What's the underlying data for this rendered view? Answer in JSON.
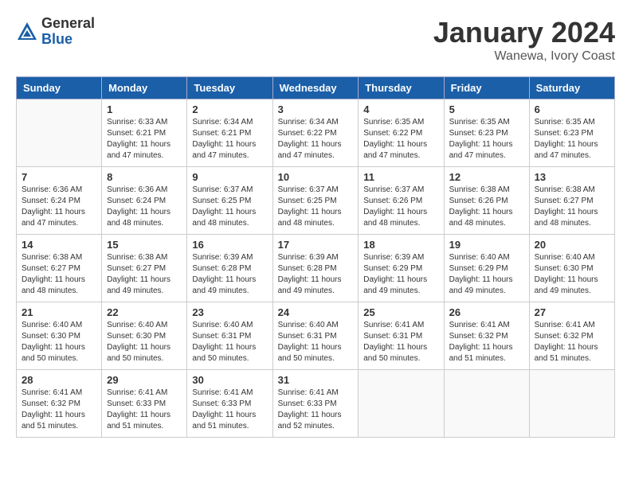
{
  "header": {
    "logo_general": "General",
    "logo_blue": "Blue",
    "month_title": "January 2024",
    "location": "Wanewa, Ivory Coast"
  },
  "weekdays": [
    "Sunday",
    "Monday",
    "Tuesday",
    "Wednesday",
    "Thursday",
    "Friday",
    "Saturday"
  ],
  "weeks": [
    [
      {
        "day": "",
        "sunrise": "",
        "sunset": "",
        "daylight": ""
      },
      {
        "day": "1",
        "sunrise": "Sunrise: 6:33 AM",
        "sunset": "Sunset: 6:21 PM",
        "daylight": "Daylight: 11 hours and 47 minutes."
      },
      {
        "day": "2",
        "sunrise": "Sunrise: 6:34 AM",
        "sunset": "Sunset: 6:21 PM",
        "daylight": "Daylight: 11 hours and 47 minutes."
      },
      {
        "day": "3",
        "sunrise": "Sunrise: 6:34 AM",
        "sunset": "Sunset: 6:22 PM",
        "daylight": "Daylight: 11 hours and 47 minutes."
      },
      {
        "day": "4",
        "sunrise": "Sunrise: 6:35 AM",
        "sunset": "Sunset: 6:22 PM",
        "daylight": "Daylight: 11 hours and 47 minutes."
      },
      {
        "day": "5",
        "sunrise": "Sunrise: 6:35 AM",
        "sunset": "Sunset: 6:23 PM",
        "daylight": "Daylight: 11 hours and 47 minutes."
      },
      {
        "day": "6",
        "sunrise": "Sunrise: 6:35 AM",
        "sunset": "Sunset: 6:23 PM",
        "daylight": "Daylight: 11 hours and 47 minutes."
      }
    ],
    [
      {
        "day": "7",
        "sunrise": "Sunrise: 6:36 AM",
        "sunset": "Sunset: 6:24 PM",
        "daylight": "Daylight: 11 hours and 47 minutes."
      },
      {
        "day": "8",
        "sunrise": "Sunrise: 6:36 AM",
        "sunset": "Sunset: 6:24 PM",
        "daylight": "Daylight: 11 hours and 48 minutes."
      },
      {
        "day": "9",
        "sunrise": "Sunrise: 6:37 AM",
        "sunset": "Sunset: 6:25 PM",
        "daylight": "Daylight: 11 hours and 48 minutes."
      },
      {
        "day": "10",
        "sunrise": "Sunrise: 6:37 AM",
        "sunset": "Sunset: 6:25 PM",
        "daylight": "Daylight: 11 hours and 48 minutes."
      },
      {
        "day": "11",
        "sunrise": "Sunrise: 6:37 AM",
        "sunset": "Sunset: 6:26 PM",
        "daylight": "Daylight: 11 hours and 48 minutes."
      },
      {
        "day": "12",
        "sunrise": "Sunrise: 6:38 AM",
        "sunset": "Sunset: 6:26 PM",
        "daylight": "Daylight: 11 hours and 48 minutes."
      },
      {
        "day": "13",
        "sunrise": "Sunrise: 6:38 AM",
        "sunset": "Sunset: 6:27 PM",
        "daylight": "Daylight: 11 hours and 48 minutes."
      }
    ],
    [
      {
        "day": "14",
        "sunrise": "Sunrise: 6:38 AM",
        "sunset": "Sunset: 6:27 PM",
        "daylight": "Daylight: 11 hours and 48 minutes."
      },
      {
        "day": "15",
        "sunrise": "Sunrise: 6:38 AM",
        "sunset": "Sunset: 6:27 PM",
        "daylight": "Daylight: 11 hours and 49 minutes."
      },
      {
        "day": "16",
        "sunrise": "Sunrise: 6:39 AM",
        "sunset": "Sunset: 6:28 PM",
        "daylight": "Daylight: 11 hours and 49 minutes."
      },
      {
        "day": "17",
        "sunrise": "Sunrise: 6:39 AM",
        "sunset": "Sunset: 6:28 PM",
        "daylight": "Daylight: 11 hours and 49 minutes."
      },
      {
        "day": "18",
        "sunrise": "Sunrise: 6:39 AM",
        "sunset": "Sunset: 6:29 PM",
        "daylight": "Daylight: 11 hours and 49 minutes."
      },
      {
        "day": "19",
        "sunrise": "Sunrise: 6:40 AM",
        "sunset": "Sunset: 6:29 PM",
        "daylight": "Daylight: 11 hours and 49 minutes."
      },
      {
        "day": "20",
        "sunrise": "Sunrise: 6:40 AM",
        "sunset": "Sunset: 6:30 PM",
        "daylight": "Daylight: 11 hours and 49 minutes."
      }
    ],
    [
      {
        "day": "21",
        "sunrise": "Sunrise: 6:40 AM",
        "sunset": "Sunset: 6:30 PM",
        "daylight": "Daylight: 11 hours and 50 minutes."
      },
      {
        "day": "22",
        "sunrise": "Sunrise: 6:40 AM",
        "sunset": "Sunset: 6:30 PM",
        "daylight": "Daylight: 11 hours and 50 minutes."
      },
      {
        "day": "23",
        "sunrise": "Sunrise: 6:40 AM",
        "sunset": "Sunset: 6:31 PM",
        "daylight": "Daylight: 11 hours and 50 minutes."
      },
      {
        "day": "24",
        "sunrise": "Sunrise: 6:40 AM",
        "sunset": "Sunset: 6:31 PM",
        "daylight": "Daylight: 11 hours and 50 minutes."
      },
      {
        "day": "25",
        "sunrise": "Sunrise: 6:41 AM",
        "sunset": "Sunset: 6:31 PM",
        "daylight": "Daylight: 11 hours and 50 minutes."
      },
      {
        "day": "26",
        "sunrise": "Sunrise: 6:41 AM",
        "sunset": "Sunset: 6:32 PM",
        "daylight": "Daylight: 11 hours and 51 minutes."
      },
      {
        "day": "27",
        "sunrise": "Sunrise: 6:41 AM",
        "sunset": "Sunset: 6:32 PM",
        "daylight": "Daylight: 11 hours and 51 minutes."
      }
    ],
    [
      {
        "day": "28",
        "sunrise": "Sunrise: 6:41 AM",
        "sunset": "Sunset: 6:32 PM",
        "daylight": "Daylight: 11 hours and 51 minutes."
      },
      {
        "day": "29",
        "sunrise": "Sunrise: 6:41 AM",
        "sunset": "Sunset: 6:33 PM",
        "daylight": "Daylight: 11 hours and 51 minutes."
      },
      {
        "day": "30",
        "sunrise": "Sunrise: 6:41 AM",
        "sunset": "Sunset: 6:33 PM",
        "daylight": "Daylight: 11 hours and 51 minutes."
      },
      {
        "day": "31",
        "sunrise": "Sunrise: 6:41 AM",
        "sunset": "Sunset: 6:33 PM",
        "daylight": "Daylight: 11 hours and 52 minutes."
      },
      {
        "day": "",
        "sunrise": "",
        "sunset": "",
        "daylight": ""
      },
      {
        "day": "",
        "sunrise": "",
        "sunset": "",
        "daylight": ""
      },
      {
        "day": "",
        "sunrise": "",
        "sunset": "",
        "daylight": ""
      }
    ]
  ]
}
